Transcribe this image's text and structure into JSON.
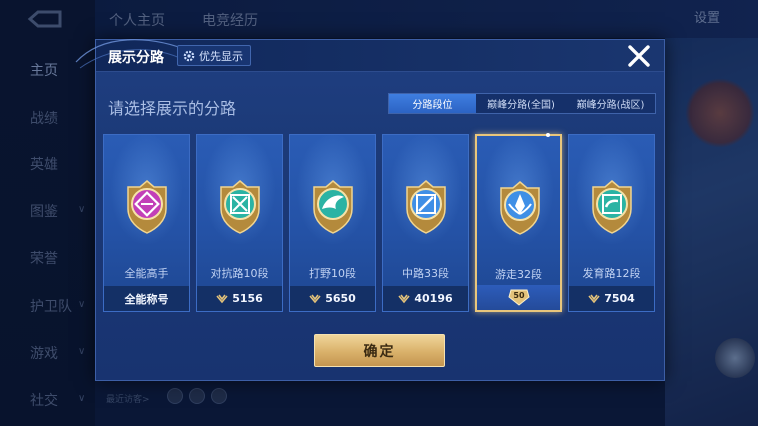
{
  "background": {
    "top_tabs": [
      "个人主页",
      "电竞经历"
    ],
    "settings_label": "设置",
    "sidebar": [
      {
        "label": "主页",
        "active": true,
        "arrow": false
      },
      {
        "label": "战绩",
        "active": false,
        "arrow": false
      },
      {
        "label": "英雄",
        "active": false,
        "arrow": false
      },
      {
        "label": "图鉴",
        "active": false,
        "arrow": true
      },
      {
        "label": "荣誉",
        "active": false,
        "arrow": false
      },
      {
        "label": "护卫队",
        "active": false,
        "arrow": true
      },
      {
        "label": "游戏",
        "active": false,
        "arrow": true
      },
      {
        "label": "社交",
        "active": false,
        "arrow": true
      }
    ],
    "recent_visitors_label": "最近访客>"
  },
  "modal": {
    "title": "展示分路",
    "priority_button": "优先显示",
    "subtitle": "请选择展示的分路",
    "tabs": [
      {
        "label": "分路段位",
        "active": true
      },
      {
        "label": "巅峰分路(全国)",
        "active": false
      },
      {
        "label": "巅峰分路(战区)",
        "active": false
      }
    ],
    "cards": [
      {
        "name": "全能高手",
        "footer": "全能称号",
        "icon": "all-rounder-emblem-icon",
        "color": "#c23fb8",
        "selected": false,
        "show_chevron": false
      },
      {
        "name": "对抗路10段",
        "footer": "5156",
        "icon": "clash-lane-emblem-icon",
        "color": "#2bb3a4",
        "selected": false,
        "show_chevron": true
      },
      {
        "name": "打野10段",
        "footer": "5650",
        "icon": "jungle-emblem-icon",
        "color": "#2bb3a4",
        "selected": false,
        "show_chevron": true
      },
      {
        "name": "中路33段",
        "footer": "40196",
        "icon": "mid-lane-emblem-icon",
        "color": "#3f8fe6",
        "selected": false,
        "show_chevron": true
      },
      {
        "name": "游走32段",
        "footer": "50",
        "icon": "roam-emblem-icon",
        "color": "#3f8fe6",
        "selected": true,
        "show_chevron": false
      },
      {
        "name": "发育路12段",
        "footer": "7504",
        "icon": "farm-lane-emblem-icon",
        "color": "#2bb3a4",
        "selected": false,
        "show_chevron": true
      }
    ],
    "confirm_label": "确定",
    "colors": {
      "accent_gold": "#e9c67c",
      "tab_active": "#3f7ee0"
    }
  }
}
